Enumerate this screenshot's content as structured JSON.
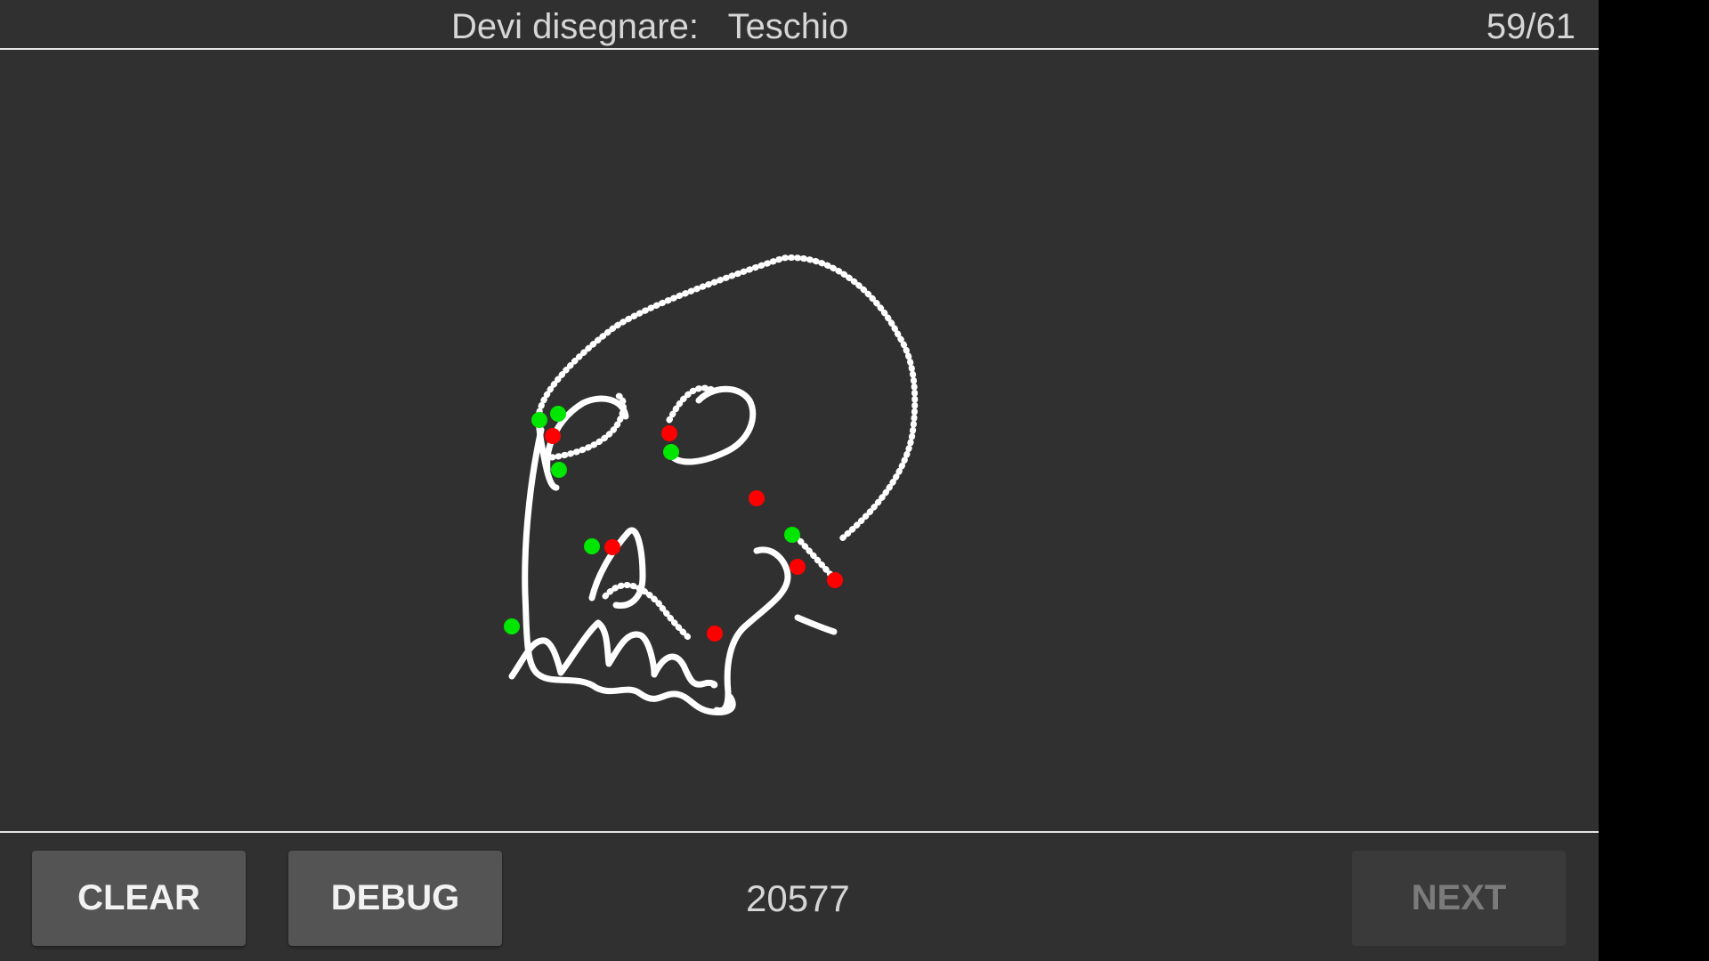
{
  "header": {
    "prompt_label": "Devi disegnare:",
    "target_word": "Teschio",
    "progress": "59/61"
  },
  "footer": {
    "clear_label": "CLEAR",
    "debug_label": "DEBUG",
    "score": "20577",
    "next_label": "NEXT",
    "next_enabled": false
  },
  "colors": {
    "background": "#303030",
    "stroke": "#ffffff",
    "stroke_start_marker": "#00e600",
    "stroke_end_marker": "#ff0000",
    "button": "#545454",
    "button_disabled": "#3a3a3a"
  }
}
